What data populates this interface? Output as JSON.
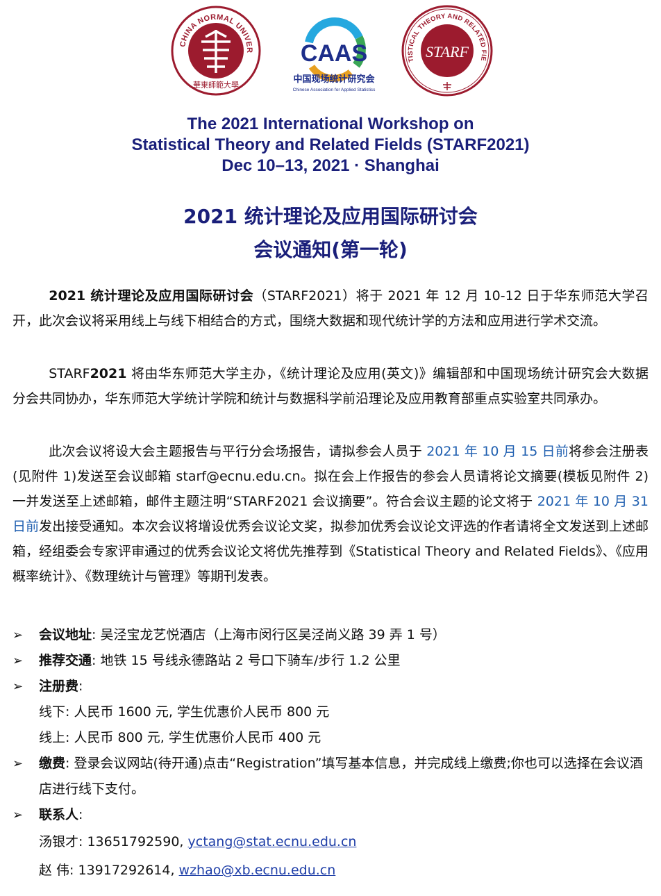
{
  "logos": {
    "ecnu": {
      "ring_text": "EAST CHINA NORMAL UNIVERSITY",
      "cn_text": "華東師範大學",
      "color": "#9c1b2e"
    },
    "caas": {
      "mark": "CAAS",
      "cn_name": "中国现场统计研究会",
      "en_name": "Chinese Association for Applied Statistics",
      "colors": [
        "#1d2e8a",
        "#25a8df",
        "#3aa656",
        "#e8a020"
      ]
    },
    "starf": {
      "ring_text": "STATISTICAL THEORY AND RELATED FIELDS",
      "mark": "STARF",
      "color": "#9c1b2e"
    }
  },
  "title_en": {
    "line1": "The 2021 International Workshop on",
    "line2": "Statistical Theory and Related Fields (STARF2021)",
    "line3": "Dec 10–13, 2021 · Shanghai"
  },
  "title_cn": {
    "line1": "2021  统计理论及应用国际研讨会",
    "line2": "会议通知(第一轮)"
  },
  "para1": {
    "bold_name": "2021 统计理论及应用国际研讨会",
    "text": "（STARF2021）将于  2021 年  12 月  10-12 日于华东师范大学召开，此次会议将采用线上与线下相结合的方式，围绕大数据和现代统计学的方法和应用进行学术交流。"
  },
  "para2": {
    "prefix": "STARF",
    "bold_year": "2021",
    "text": " 将由华东师范大学主办，《统计理论及应用(英文)》编辑部和中国现场统计研究会大数据分会共同协办，华东师范大学统计学院和统计与数据科学前沿理论及应用教育部重点实验室共同承办。"
  },
  "para3": {
    "t1": "此次会议将设大会主题报告与平行分会场报告，请拟参会人员于 ",
    "deadline1": "2021 年  10 月  15 日前",
    "t2": "将参会注册表(见附件  1)发送至会议邮箱  starf@ecnu.edu.cn。拟在会上作报告的参会人员请将论文摘要(模板见附件  2)一并发送至上述邮箱，邮件主题注明“STARF2021 会议摘要”。符合会议主题的论文将于  ",
    "deadline2": "2021 年  10 月  31 日前",
    "t3": "发出接受通知。本次会议将增设优秀会议论文奖，拟参加优秀会议论文评选的作者请将全文发送到上述邮箱，经组委会专家评审通过的优秀会议论文将优先推荐到《Statistical Theory and Related Fields》、《应用概率统计》、《数理统计与管理》等期刊发表。"
  },
  "bullets": {
    "arrow": "➢",
    "venue_label": "会议地址",
    "venue_text": ": 吴泾宝龙艺悦酒店（上海市闵行区吴泾尚义路 39  弄 1  号）",
    "transport_label": "推荐交通",
    "transport_text": ":  地铁  15 号线永德路站  2 号口下骑车/步行  1.2 公里",
    "fee_label": "注册费",
    "fee_colon": ":",
    "fee_offline": "线下: 人民币  1600 元, 学生优惠价人民币  800 元",
    "fee_online": "线上: 人民币  800 元, 学生优惠价人民币  400 元",
    "pay_label": "缴费",
    "pay_text": ": 登录会议网站(待开通)点击“Registration”填写基本信息，并完成线上缴费;你也可以选择在会议酒店进行线下支付。",
    "contact_label": "联系人",
    "contact_colon": ":",
    "contact1_name": "汤银才: 13651792590, ",
    "contact1_email": "yctang@stat.ecnu.edu.cn",
    "contact2_name": "赵    伟: 13917292614, ",
    "contact2_email": "wzhao@xb.ecnu.edu.cn"
  }
}
